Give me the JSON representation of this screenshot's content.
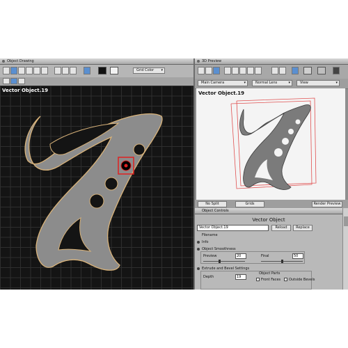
{
  "object_drawing": {
    "panel_title": "Object Drawing",
    "grid_color_label": "Grid Color",
    "canvas_title": "Vector Object.19"
  },
  "preview": {
    "panel_title": "3D Preview",
    "camera": "Main Camera",
    "lens": "Normal Lens",
    "view": "View",
    "canvas_title": "Vector Object.19",
    "no_split": "No Split",
    "grids": "Grids",
    "render_preview": "Render Preview"
  },
  "object_controls": {
    "panel_title": "Object Controls",
    "title": "Vector Object",
    "name_value": "Vector Object.19",
    "reload": "Reload",
    "replace": "Replace",
    "filename_label": "Filename",
    "info_label": "Info",
    "smoothness_label": "Object Smoothness",
    "preview_label": "Preview",
    "preview_value": "20",
    "final_label": "Final",
    "final_value": "50",
    "extrude_label": "Extrude and Bevel Settings",
    "depth_label": "Depth",
    "depth_value": "19",
    "object_parts_label": "Object Parts",
    "front_faces_label": "Front Faces",
    "outside_bevels_label": "Outside Bevels"
  },
  "colors": {
    "canvas_bg": "#141414",
    "shape_fill": "#8c8c8c",
    "shape_outline": "#d9b37a",
    "selection": "#e02020",
    "bounding_box": "#e05050",
    "accent_tool": "#5a8fd0"
  }
}
